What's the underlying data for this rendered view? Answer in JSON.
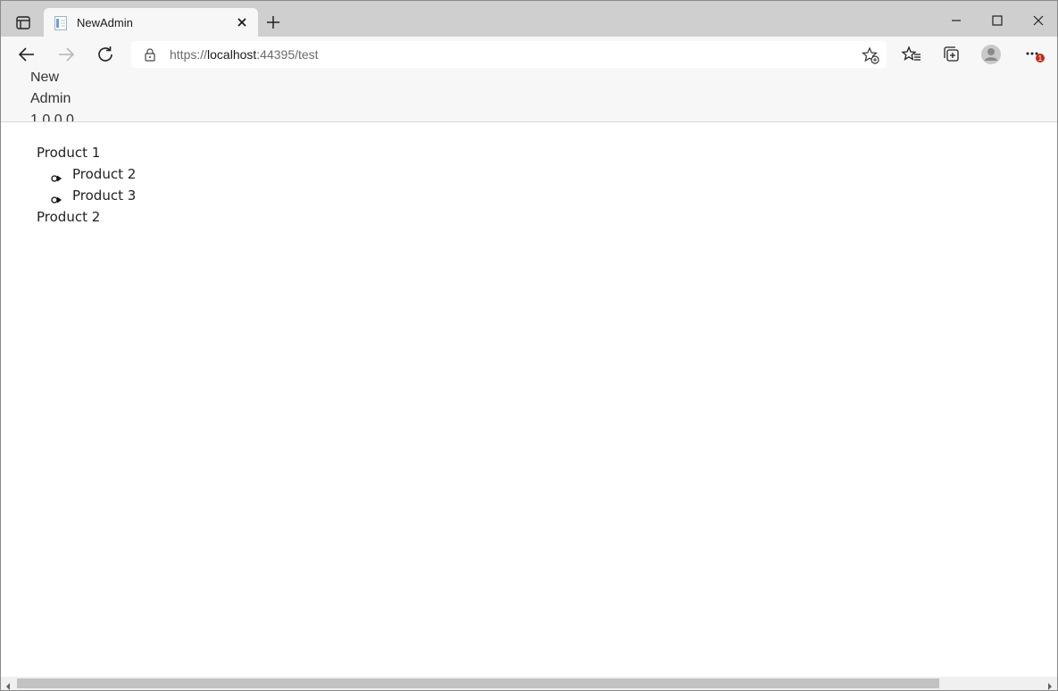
{
  "browser": {
    "tab_title": "NewAdmin",
    "address": {
      "scheme": "https://",
      "host": "localhost",
      "rest": ":44395/test"
    },
    "notification_badge": "1",
    "icons": [
      "tab-actions-icon",
      "page-favicon",
      "close-icon",
      "plus-icon",
      "minimize-icon",
      "maximize-icon",
      "close-window-icon",
      "back-arrow-icon",
      "forward-arrow-icon",
      "refresh-icon",
      "lock-icon",
      "favorite-add-icon",
      "favorites-icon",
      "collections-icon",
      "profile-icon",
      "more-icon"
    ]
  },
  "app": {
    "brand_lines": [
      "New",
      "Admin",
      "1.0.0.0"
    ]
  },
  "tree": {
    "items": [
      {
        "label": "Product 1",
        "children": [
          {
            "label": "Product 2"
          },
          {
            "label": "Product 3"
          }
        ]
      },
      {
        "label": "Product 2",
        "children": []
      }
    ]
  },
  "colors": {
    "tabstrip": "#cfcfcf",
    "toolbar": "#f7f7f7",
    "badge": "#c42b1c",
    "scroll_thumb": "#c2c2c2"
  }
}
